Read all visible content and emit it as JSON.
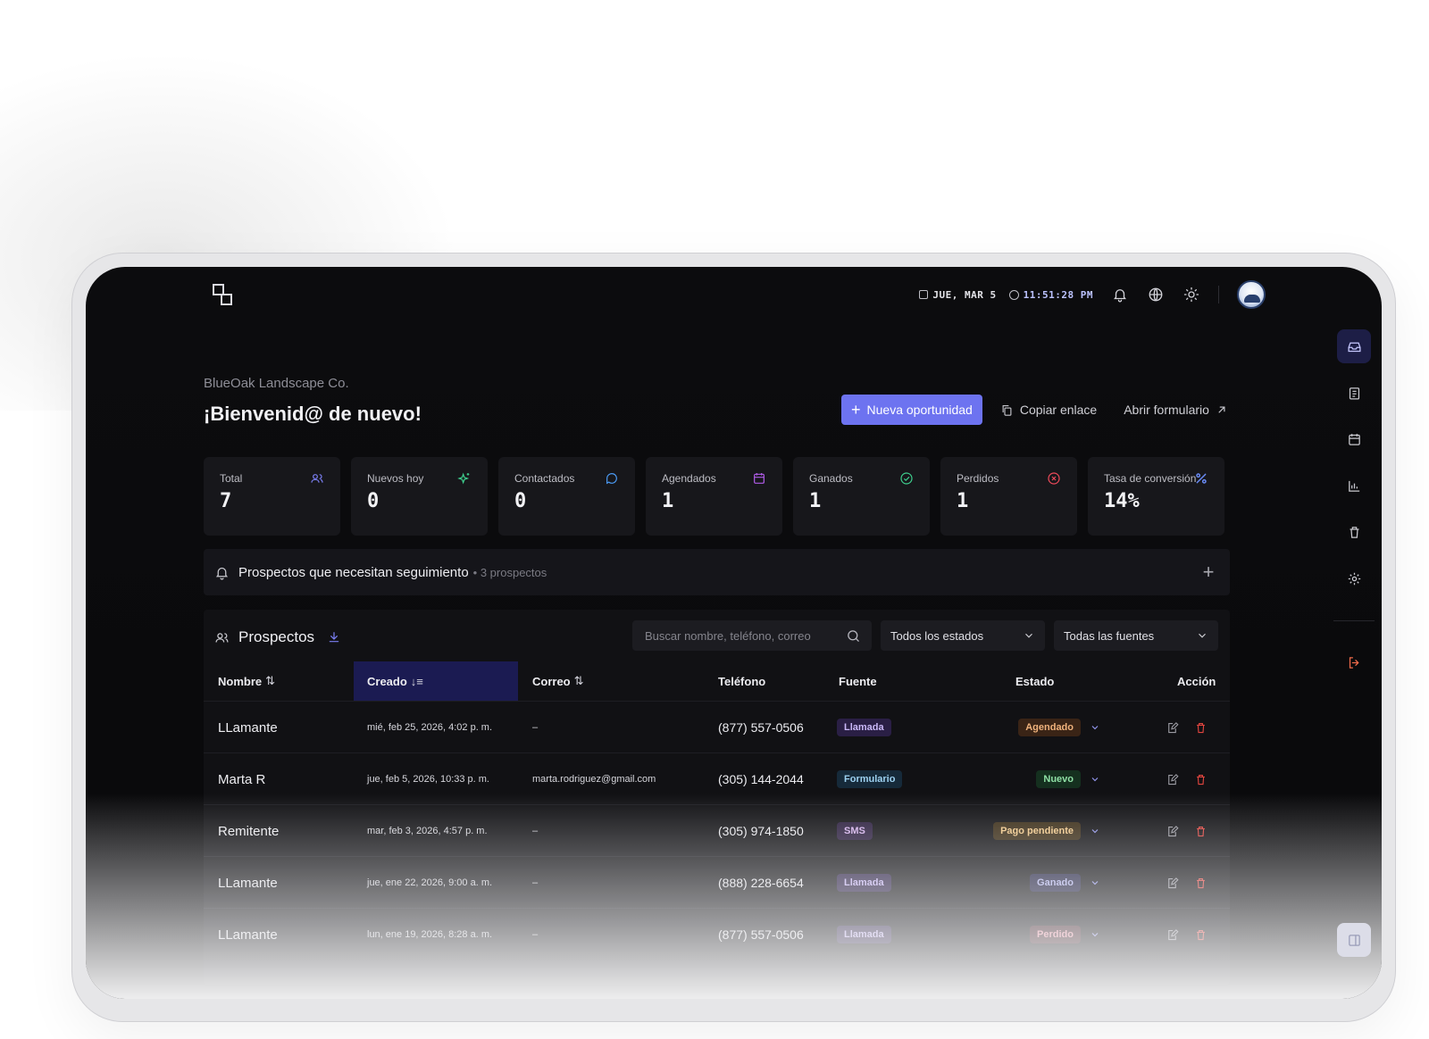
{
  "topbar": {
    "date": "JUE, MAR 5",
    "time": "11:51:28 PM",
    "icons": [
      "calendar-icon",
      "clock-icon",
      "bell-icon",
      "globe-icon",
      "sun-icon",
      "avatar"
    ]
  },
  "sidebar": {
    "items": [
      {
        "name": "inbox",
        "icon": "inbox-icon",
        "active": true
      },
      {
        "name": "clipboard",
        "icon": "clipboard-icon"
      },
      {
        "name": "calendar",
        "icon": "calendar-icon"
      },
      {
        "name": "reports",
        "icon": "bar-chart-icon"
      },
      {
        "name": "trash",
        "icon": "trash-icon"
      },
      {
        "name": "settings",
        "icon": "gear-icon"
      },
      {
        "name": "logout",
        "icon": "logout-icon"
      },
      {
        "name": "panel",
        "icon": "panel-icon"
      }
    ]
  },
  "header": {
    "company": "BlueOak Landscape Co.",
    "welcome": "¡Bienvenid@ de nuevo!",
    "new_label": "Nueva oportunidad",
    "copy_label": "Copiar enlace",
    "open_form_label": "Abrir formulario"
  },
  "stats": [
    {
      "label": "Total",
      "value": "7",
      "icon": "users-icon",
      "color": "#7b7ff2"
    },
    {
      "label": "Nuevos hoy",
      "value": "0",
      "icon": "sparkle-icon",
      "color": "#3ecf8e"
    },
    {
      "label": "Contactados",
      "value": "0",
      "icon": "chat-icon",
      "color": "#4b9bf5"
    },
    {
      "label": "Agendados",
      "value": "1",
      "icon": "calendar-icon",
      "color": "#b05ce8"
    },
    {
      "label": "Ganados",
      "value": "1",
      "icon": "check-circle-icon",
      "color": "#3ecf8e"
    },
    {
      "label": "Perdidos",
      "value": "1",
      "icon": "x-circle-icon",
      "color": "#ef4a5a"
    },
    {
      "label": "Tasa de conversión",
      "value": "14%",
      "icon": "percent-icon",
      "color": "#6a8cf7"
    }
  ],
  "followup": {
    "title": "Prospectos que necesitan seguimiento",
    "count": "• 3 prospectos"
  },
  "prospects": {
    "title": "Prospectos",
    "search_placeholder": "Buscar nombre, teléfono, correo",
    "status_filter": "Todos los estados",
    "source_filter": "Todas las fuentes",
    "columns": {
      "name": "Nombre",
      "created": "Creado",
      "email": "Correo",
      "phone": "Teléfono",
      "source": "Fuente",
      "status": "Estado",
      "action": "Acción"
    },
    "rows": [
      {
        "name": "LLamante",
        "created": "mié, feb 25, 2026, 4:02 p. m.",
        "email": "–",
        "phone": "(877) 557-0506",
        "source": "Llamada",
        "source_class": "src-llamada",
        "status": "Agendado",
        "status_class": "st-agendado"
      },
      {
        "name": "Marta R",
        "created": "jue, feb 5, 2026, 10:33 p. m.",
        "email": "marta.rodriguez@gmail.com",
        "phone": "(305) 144-2044",
        "source": "Formulario",
        "source_class": "src-form",
        "status": "Nuevo",
        "status_class": "st-nuevo"
      },
      {
        "name": "Remitente",
        "created": "mar, feb 3, 2026, 4:57 p. m.",
        "email": "–",
        "phone": "(305) 974-1850",
        "source": "SMS",
        "source_class": "src-sms",
        "status": "Pago pendiente",
        "status_class": "st-pago"
      },
      {
        "name": "LLamante",
        "created": "jue, ene 22, 2026, 9:00 a. m.",
        "email": "–",
        "phone": "(888) 228-6654",
        "source": "Llamada",
        "source_class": "src-llamada",
        "status": "Ganado",
        "status_class": "st-ganado"
      },
      {
        "name": "LLamante",
        "created": "lun, ene 19, 2026, 8:28 a. m.",
        "email": "–",
        "phone": "(877) 557-0506",
        "source": "Llamada",
        "source_class": "src-llamada",
        "status": "Perdido",
        "status_class": "st-perdido"
      }
    ]
  }
}
